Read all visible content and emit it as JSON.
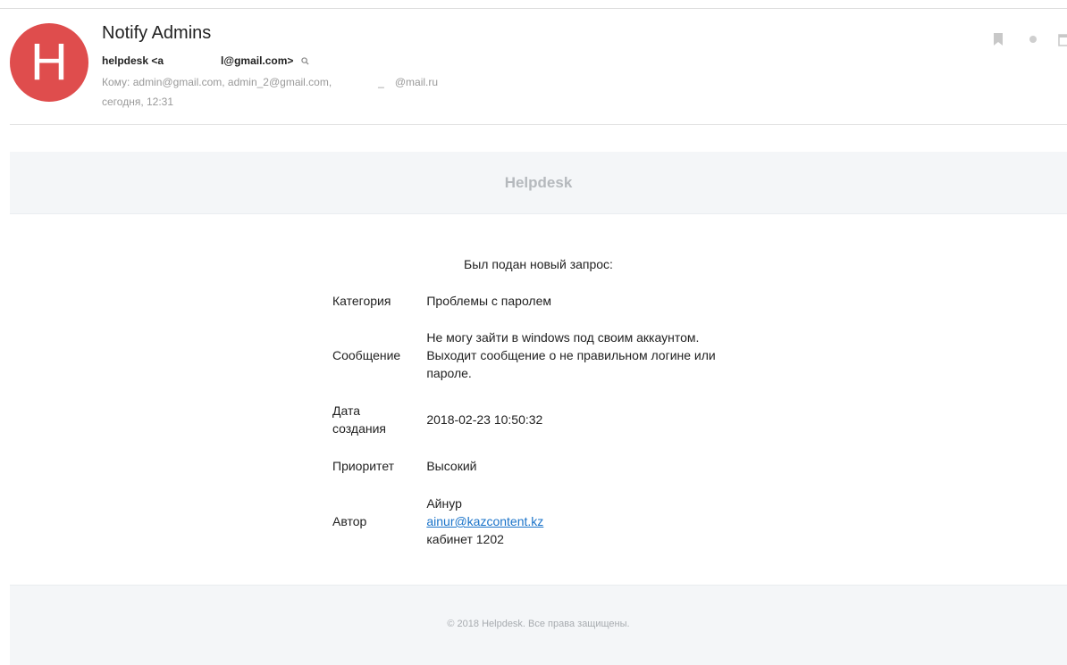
{
  "header": {
    "avatar_letter": "H",
    "subject": "Notify Admins",
    "from_name": "helpdesk <a",
    "from_email_tail": "l@gmail.com>",
    "to_label_text": "Кому: admin@gmail.com, admin_2@gmail.com,",
    "to_underscore": "_",
    "to_tail": "@mail.ru",
    "date": "сегодня, 12:31",
    "icons": [
      "search-icon",
      "bookmark-icon",
      "dot-icon",
      "calendar-icon"
    ]
  },
  "mail": {
    "brand_title": "Helpdesk",
    "intro": "Был подан новый запрос:",
    "rows": [
      {
        "label": "Категория",
        "value_lines": [
          "Проблемы с паролем"
        ]
      },
      {
        "label": "Сообщение",
        "value_lines": [
          "Не могу зайти в windows под своим аккаунтом.",
          "Выходит сообщение о не правильном логине или",
          "пароле."
        ]
      },
      {
        "label_lines": [
          "Дата",
          "создания"
        ],
        "value_lines": [
          "2018-02-23 10:50:32"
        ]
      },
      {
        "label": "Приоритет",
        "value_lines": [
          "Высокий"
        ]
      },
      {
        "label": "Автор",
        "value_lines": [
          "Айнур",
          "ainur@kazcontent.kz",
          "кабинет 1202"
        ]
      }
    ],
    "footer": "© 2018 Helpdesk. Все права защищены."
  },
  "colors": {
    "avatar": "#df4d4d",
    "link": "#1a73c9",
    "panel_bg": "#f4f6f8"
  }
}
